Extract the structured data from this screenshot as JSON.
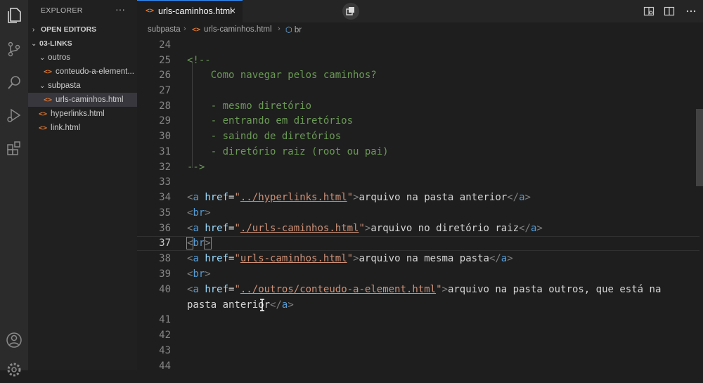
{
  "activity_bar": {
    "icons": [
      "files-icon",
      "source-control-icon",
      "search-icon",
      "run-debug-icon",
      "extensions-icon",
      "account-icon",
      "settings-icon"
    ]
  },
  "explorer": {
    "title": "EXPLORER",
    "more": "···",
    "open_editors": "OPEN EDITORS",
    "root": "03-LINKS",
    "tree": [
      {
        "label": "outros",
        "type": "folder"
      },
      {
        "label": "conteudo-a-element...",
        "type": "html"
      },
      {
        "label": "subpasta",
        "type": "folder"
      },
      {
        "label": "urls-caminhos.html",
        "type": "html"
      },
      {
        "label": "hyperlinks.html",
        "type": "html"
      },
      {
        "label": "link.html",
        "type": "html"
      }
    ]
  },
  "tab": {
    "icon": "<>",
    "label": "urls-caminhos.html",
    "close": "×"
  },
  "breadcrumb": {
    "folder": "subpasta",
    "file": "urls-caminhos.html",
    "symbol": "br",
    "sep": "›"
  },
  "editor": {
    "line_numbers": [
      "24",
      "25",
      "26",
      "27",
      "28",
      "29",
      "30",
      "31",
      "32",
      "33",
      "34",
      "35",
      "36",
      "37",
      "38",
      "39",
      "40",
      "",
      "41",
      "42",
      "43",
      "44"
    ],
    "comment": {
      "open": "<!--",
      "title": "    Como navegar pelos caminhos?",
      "items": [
        "    - mesmo diretório",
        "    - entrando em diretórios",
        "    - saindo de diretórios",
        "    - diretório raiz (root ou pai)"
      ],
      "close": "-->"
    },
    "links": [
      {
        "href": "../hyperlinks.html",
        "text": "arquivo na pasta anterior"
      },
      {
        "href": "./urls-caminhos.html",
        "text": "arquivo no diretório raiz"
      },
      {
        "href": "urls-caminhos.html",
        "text": "arquivo na mesma pasta"
      },
      {
        "href": "../outros/conteudo-a-element.html",
        "text": "arquivo na pasta outros, que está na",
        "text_wrap": "pasta anterior"
      }
    ],
    "tag_a": "a",
    "tag_br": "br",
    "attr_href": "href"
  }
}
